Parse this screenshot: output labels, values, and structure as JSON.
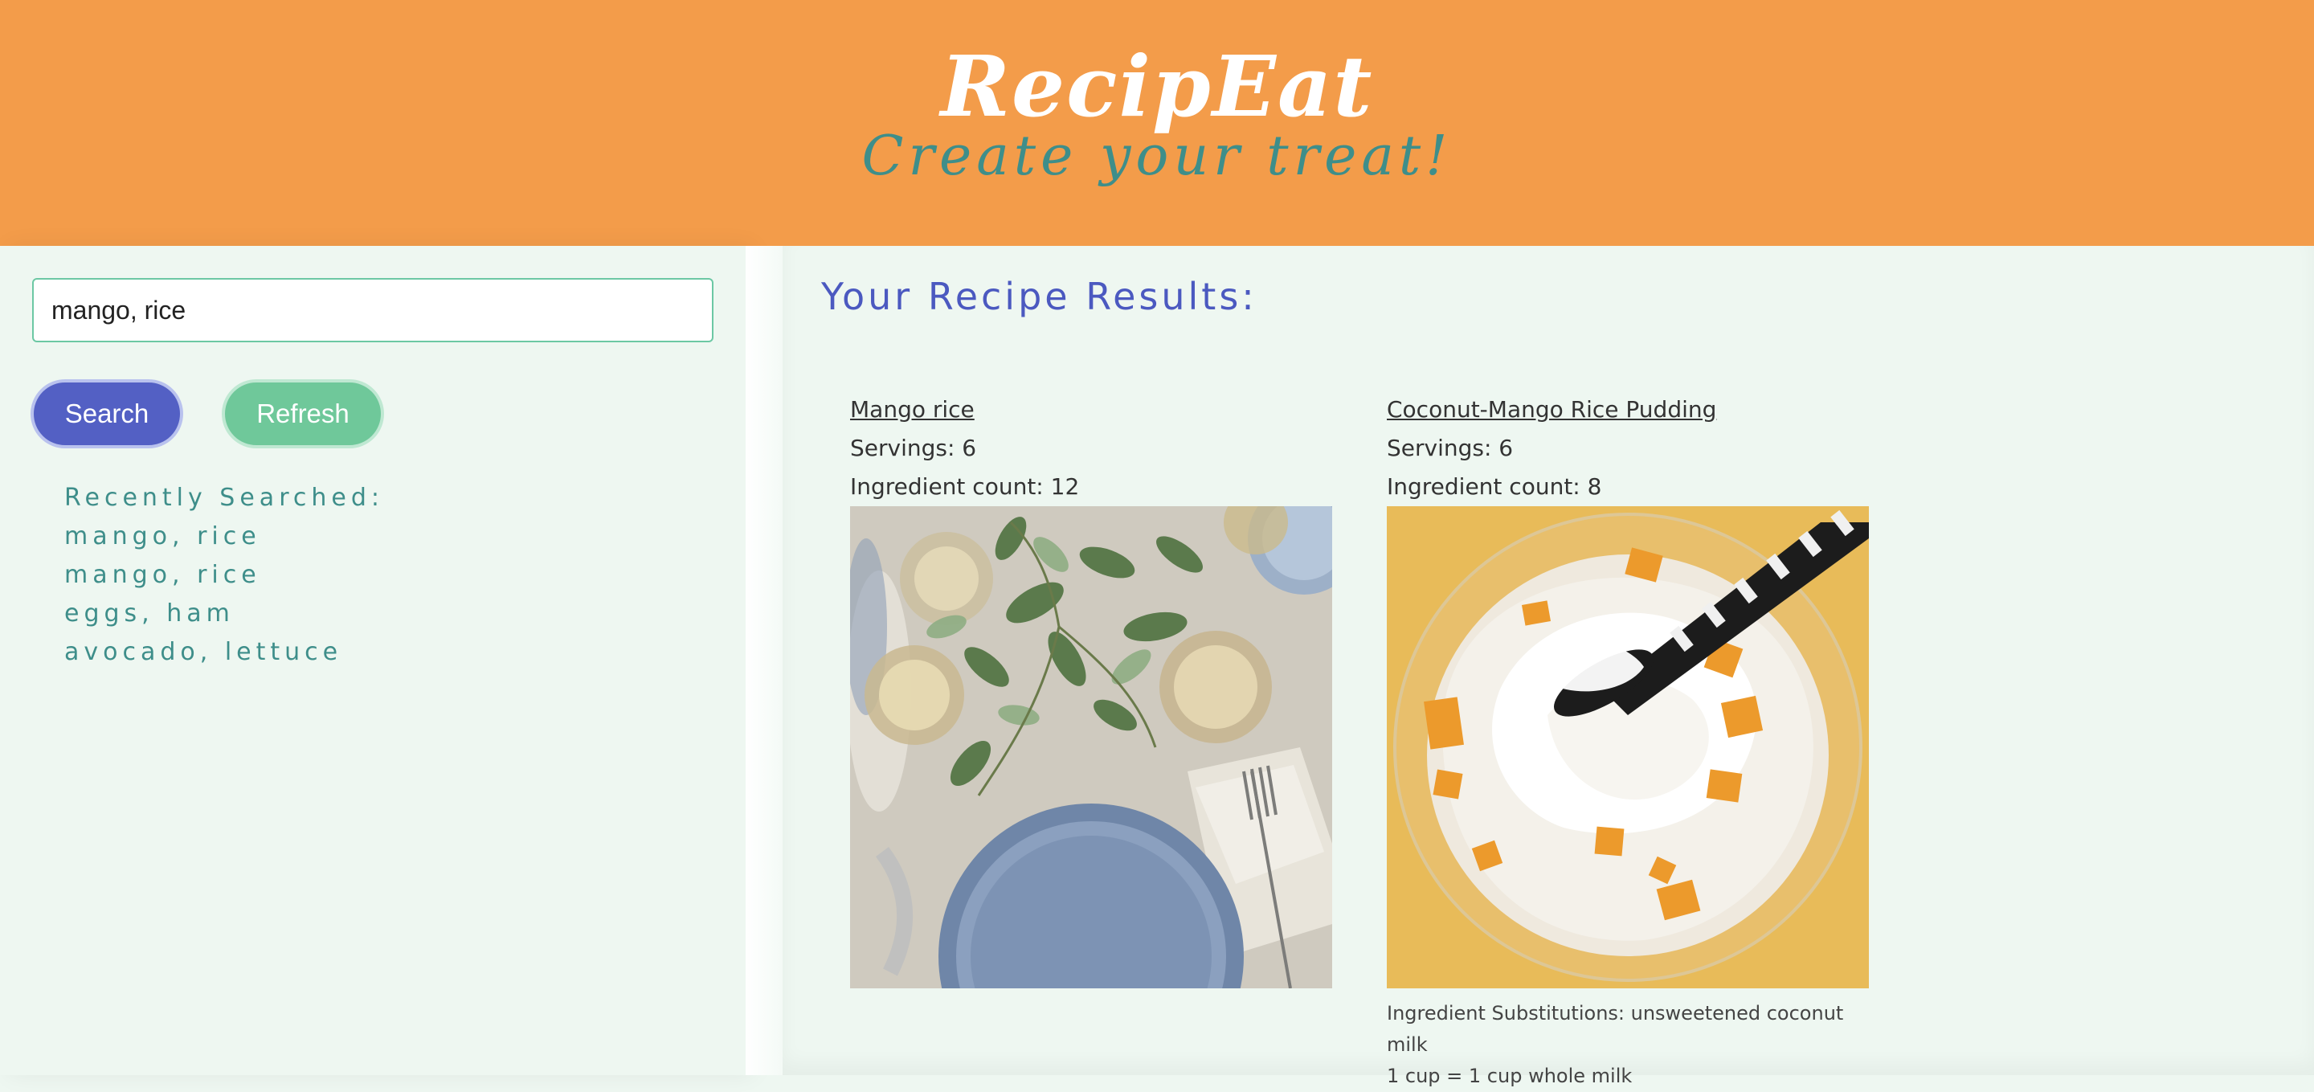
{
  "header": {
    "brand": "RecipEat",
    "tagline": "Create your treat!"
  },
  "sidebar": {
    "search_value": "mango, rice",
    "search_label": "Search",
    "refresh_label": "Refresh",
    "recent_heading": "Recently Searched:",
    "recent_items": [
      "mango, rice",
      "mango, rice",
      "eggs, ham",
      "avocado, lettuce"
    ]
  },
  "main": {
    "results_title": "Your Recipe Results:",
    "recipes": [
      {
        "title": "Mango rice",
        "servings": "Servings: 6",
        "ingredient_count": "Ingredient count: 12",
        "image": "table-setting-photo"
      },
      {
        "title": "Coconut-Mango Rice Pudding",
        "servings": "Servings: 6",
        "ingredient_count": "Ingredient count: 8",
        "image": "rice-pudding-photo",
        "substitution_line1": "Ingredient Substitutions: unsweetened coconut milk",
        "substitution_line2": "1 cup = 1 cup whole milk"
      }
    ]
  },
  "colors": {
    "header_bg": "#f39c4a",
    "tagline": "#3e8e8a",
    "page_bg": "#eef7f1",
    "search_button": "#5360c4",
    "refresh_button": "#6fc89a",
    "results_title": "#4b59c0"
  }
}
